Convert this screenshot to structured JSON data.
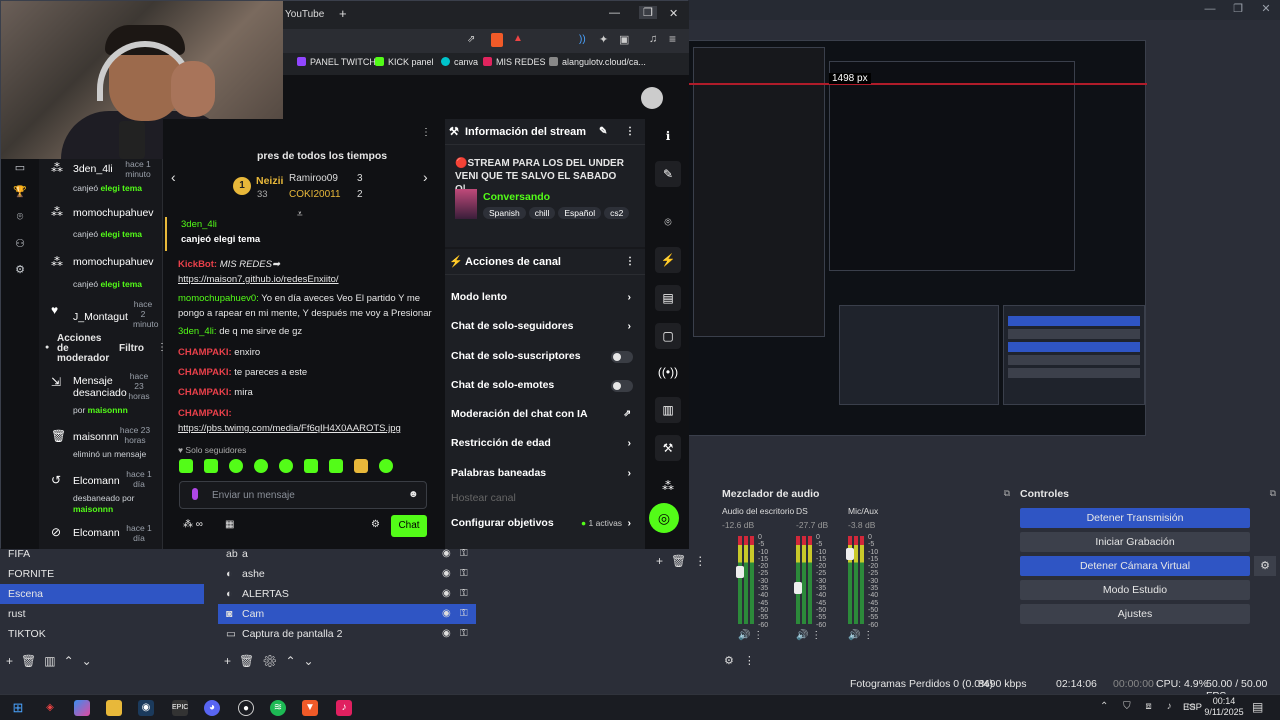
{
  "taskbar": {
    "time": "00:14",
    "date": "9/11/2025",
    "lang": "ESP"
  },
  "status": {
    "dropped": "Fotogramas Perdidos 0 (0.0%)",
    "kbps": "8490 kbps",
    "stream_time": "02:14:06",
    "rec_time": "00:00:00",
    "cpu": "CPU: 4.9%",
    "fps": "50.00 / 50.00 FPS"
  },
  "scenes": {
    "items": [
      "FIFA",
      "FORNITE",
      "Escena",
      "rust",
      "TIKTOK"
    ],
    "selected": 2
  },
  "sources": {
    "items": [
      "a",
      "ashe",
      "ALERTAS",
      "Cam",
      "Captura de pantalla 2"
    ],
    "selected": 3
  },
  "mixer": {
    "title": "Mezclador de audio",
    "channels": [
      {
        "name": "Audio del escritorio",
        "db": "-12.6 dB"
      },
      {
        "name": "DS",
        "db": "-27.7 dB"
      },
      {
        "name": "Mic/Aux",
        "db": "-3.8 dB"
      }
    ],
    "scale": [
      "0",
      "-5",
      "-10",
      "-15",
      "-20",
      "-25",
      "-30",
      "-35",
      "-40",
      "-45",
      "-50",
      "-55",
      "-60"
    ]
  },
  "controls": {
    "title": "Controles",
    "buttons": [
      "Detener Transmisión",
      "Iniciar Grabación",
      "Detener Cámara Virtual",
      "Modo Estudio",
      "Ajustes"
    ]
  },
  "preview": {
    "px_label": "1498 px"
  },
  "browser": {
    "tab_title": "YouTube",
    "bookmarks": [
      "PANEL TWITCH",
      "KICK panel",
      "canva",
      "MIS REDES",
      "alangulotv.cloud/ca..."
    ]
  },
  "mod_log": {
    "items": [
      {
        "user": "3den_4li",
        "ago": "hace 1 minuto",
        "action": "canjeó",
        "target": "elegi tema"
      },
      {
        "user": "momochupahuev",
        "ago": "",
        "action": "canjeó",
        "target": "elegi tema"
      },
      {
        "user": "momochupahuev",
        "ago": "",
        "action": "canjeó",
        "target": "elegi tema"
      },
      {
        "user": "J_Montagut",
        "ago": "hace 2 minuto",
        "action": "",
        "target": ""
      }
    ],
    "header": "Acciones de moderador",
    "filter": "Filtro",
    "actions": [
      {
        "title": "Mensaje desanciado",
        "ago": "hace 23 horas",
        "by": "por",
        "who": "maisonnn"
      },
      {
        "title": "maisonnn",
        "ago": "hace 23 horas",
        "by": "eliminó un mensaje",
        "who": ""
      },
      {
        "title": "Elcomann",
        "ago": "hace 1 día",
        "by": "desbaneado por",
        "who": "maisonnn"
      },
      {
        "title": "Elcomann",
        "ago": "hace 1 día",
        "by": "",
        "who": ""
      }
    ]
  },
  "leaderboard": {
    "title": "pres de todos los tiempos",
    "first": "Neizii",
    "first_count": "33",
    "second": "Ramiroo09",
    "second_count": "3",
    "third": "COKI20011",
    "third_count": "2"
  },
  "chat": {
    "messages": [
      {
        "user": "3den_4li",
        "text": "canjeó elegi tema"
      },
      {
        "user": "KickBot:",
        "text": "MIS REDES➡",
        "link": "https://maison7.github.io/redesEnxiito/"
      },
      {
        "user": "momochupahuev0:",
        "text": "Yo en día aveces Veo El partido Y me pongo a rapear en mi mente, Y después me voy a Presionar"
      },
      {
        "user": "3den_4li:",
        "text": "de q me sirve de gz"
      },
      {
        "user": "CHAMPAKI:",
        "text": "enxiro"
      },
      {
        "user": "CHAMPAKI:",
        "text": "te pareces a este"
      },
      {
        "user": "CHAMPAKI:",
        "text": "mira"
      },
      {
        "user": "CHAMPAKI:",
        "text": "",
        "link": "https://pbs.twimg.com/media/Ff6qIH4X0AAROTS.jpg"
      }
    ],
    "followers_only": "Solo seguidores",
    "placeholder": "Enviar un mensaje",
    "send": "Chat"
  },
  "stream_info": {
    "header": "Información del stream",
    "title": "🔴STREAM PARA LOS DEL UNDER VENI QUE TE SALVO EL SABADO O|...",
    "category": "Conversando",
    "tags": [
      "Spanish",
      "chill",
      "Español",
      "cs2"
    ]
  },
  "channel_actions": {
    "header": "Acciones de canal",
    "rows": [
      "Modo lento",
      "Chat de solo-seguidores",
      "Chat de solo-suscriptores",
      "Chat de solo-emotes",
      "Moderación del chat con IA",
      "Restricción de edad",
      "Palabras baneadas",
      "Hostear canal",
      "Configurar objetivos"
    ],
    "goals": "1 activas"
  }
}
